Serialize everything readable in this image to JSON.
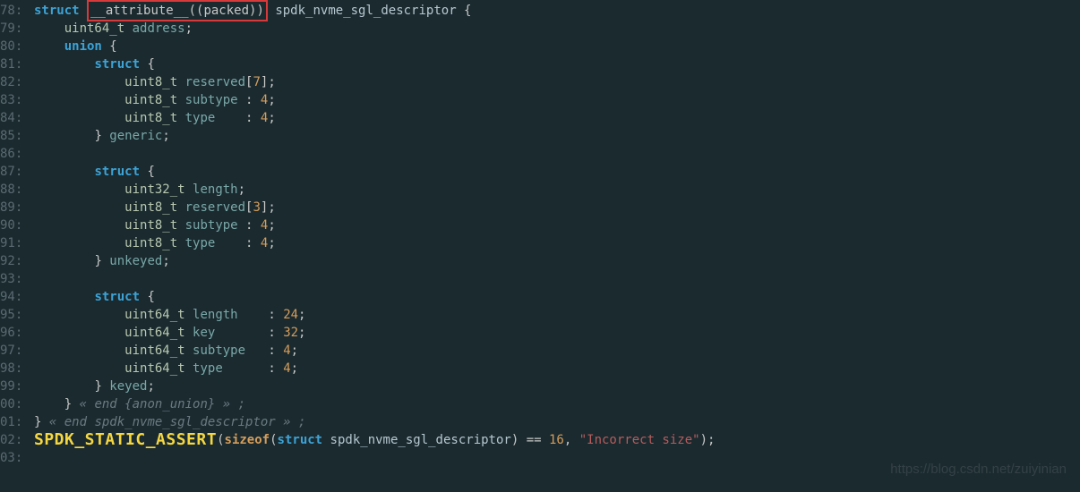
{
  "lines": [
    {
      "num": "78:",
      "indent": 0,
      "tokens": [
        {
          "t": "struct",
          "c": "kw-struct"
        },
        {
          "t": " "
        },
        {
          "t": "__attribute__((packed))",
          "c": "boxed"
        },
        {
          "t": " "
        },
        {
          "t": "spdk_nvme_sgl_descriptor",
          "c": "struct-name"
        },
        {
          "t": " {",
          "c": "punct"
        }
      ]
    },
    {
      "num": "79:",
      "indent": 1,
      "tokens": [
        {
          "t": "uint64_t",
          "c": "type-uint"
        },
        {
          "t": " "
        },
        {
          "t": "address",
          "c": "field"
        },
        {
          "t": ";",
          "c": "punct"
        }
      ]
    },
    {
      "num": "80:",
      "indent": 1,
      "tokens": [
        {
          "t": "union",
          "c": "kw-union"
        },
        {
          "t": " {",
          "c": "punct"
        }
      ]
    },
    {
      "num": "81:",
      "indent": 2,
      "tokens": [
        {
          "t": "struct",
          "c": "kw-struct"
        },
        {
          "t": " {",
          "c": "punct"
        }
      ]
    },
    {
      "num": "82:",
      "indent": 3,
      "tokens": [
        {
          "t": "uint8_t",
          "c": "type-uint"
        },
        {
          "t": " "
        },
        {
          "t": "reserved",
          "c": "field"
        },
        {
          "t": "[",
          "c": "punct"
        },
        {
          "t": "7",
          "c": "num"
        },
        {
          "t": "];",
          "c": "punct"
        }
      ]
    },
    {
      "num": "83:",
      "indent": 3,
      "tokens": [
        {
          "t": "uint8_t",
          "c": "type-uint"
        },
        {
          "t": " "
        },
        {
          "t": "subtype",
          "c": "field"
        },
        {
          "t": " : ",
          "c": "punct"
        },
        {
          "t": "4",
          "c": "num"
        },
        {
          "t": ";",
          "c": "punct"
        }
      ]
    },
    {
      "num": "84:",
      "indent": 3,
      "tokens": [
        {
          "t": "uint8_t",
          "c": "type-uint"
        },
        {
          "t": " "
        },
        {
          "t": "type",
          "c": "field"
        },
        {
          "t": "    : ",
          "c": "punct"
        },
        {
          "t": "4",
          "c": "num"
        },
        {
          "t": ";",
          "c": "punct"
        }
      ]
    },
    {
      "num": "85:",
      "indent": 2,
      "tokens": [
        {
          "t": "} ",
          "c": "punct"
        },
        {
          "t": "generic",
          "c": "field"
        },
        {
          "t": ";",
          "c": "punct"
        }
      ]
    },
    {
      "num": "86:",
      "indent": 0,
      "tokens": []
    },
    {
      "num": "87:",
      "indent": 2,
      "tokens": [
        {
          "t": "struct",
          "c": "kw-struct"
        },
        {
          "t": " {",
          "c": "punct"
        }
      ]
    },
    {
      "num": "88:",
      "indent": 3,
      "tokens": [
        {
          "t": "uint32_t",
          "c": "type-uint"
        },
        {
          "t": " "
        },
        {
          "t": "length",
          "c": "field"
        },
        {
          "t": ";",
          "c": "punct"
        }
      ]
    },
    {
      "num": "89:",
      "indent": 3,
      "tokens": [
        {
          "t": "uint8_t",
          "c": "type-uint"
        },
        {
          "t": " "
        },
        {
          "t": "reserved",
          "c": "field"
        },
        {
          "t": "[",
          "c": "punct"
        },
        {
          "t": "3",
          "c": "num"
        },
        {
          "t": "];",
          "c": "punct"
        }
      ]
    },
    {
      "num": "90:",
      "indent": 3,
      "tokens": [
        {
          "t": "uint8_t",
          "c": "type-uint"
        },
        {
          "t": " "
        },
        {
          "t": "subtype",
          "c": "field"
        },
        {
          "t": " : ",
          "c": "punct"
        },
        {
          "t": "4",
          "c": "num"
        },
        {
          "t": ";",
          "c": "punct"
        }
      ]
    },
    {
      "num": "91:",
      "indent": 3,
      "tokens": [
        {
          "t": "uint8_t",
          "c": "type-uint"
        },
        {
          "t": " "
        },
        {
          "t": "type",
          "c": "field"
        },
        {
          "t": "    : ",
          "c": "punct"
        },
        {
          "t": "4",
          "c": "num"
        },
        {
          "t": ";",
          "c": "punct"
        }
      ]
    },
    {
      "num": "92:",
      "indent": 2,
      "tokens": [
        {
          "t": "} ",
          "c": "punct"
        },
        {
          "t": "unkeyed",
          "c": "field"
        },
        {
          "t": ";",
          "c": "punct"
        }
      ]
    },
    {
      "num": "93:",
      "indent": 0,
      "tokens": []
    },
    {
      "num": "94:",
      "indent": 2,
      "tokens": [
        {
          "t": "struct",
          "c": "kw-struct"
        },
        {
          "t": " {",
          "c": "punct"
        }
      ]
    },
    {
      "num": "95:",
      "indent": 3,
      "tokens": [
        {
          "t": "uint64_t",
          "c": "type-uint"
        },
        {
          "t": " "
        },
        {
          "t": "length",
          "c": "field"
        },
        {
          "t": "    : ",
          "c": "punct"
        },
        {
          "t": "24",
          "c": "num"
        },
        {
          "t": ";",
          "c": "punct"
        }
      ]
    },
    {
      "num": "96:",
      "indent": 3,
      "tokens": [
        {
          "t": "uint64_t",
          "c": "type-uint"
        },
        {
          "t": " "
        },
        {
          "t": "key",
          "c": "field"
        },
        {
          "t": "       : ",
          "c": "punct"
        },
        {
          "t": "32",
          "c": "num"
        },
        {
          "t": ";",
          "c": "punct"
        }
      ]
    },
    {
      "num": "97:",
      "indent": 3,
      "tokens": [
        {
          "t": "uint64_t",
          "c": "type-uint"
        },
        {
          "t": " "
        },
        {
          "t": "subtype",
          "c": "field"
        },
        {
          "t": "   : ",
          "c": "punct"
        },
        {
          "t": "4",
          "c": "num"
        },
        {
          "t": ";",
          "c": "punct"
        }
      ]
    },
    {
      "num": "98:",
      "indent": 3,
      "tokens": [
        {
          "t": "uint64_t",
          "c": "type-uint"
        },
        {
          "t": " "
        },
        {
          "t": "type",
          "c": "field"
        },
        {
          "t": "      : ",
          "c": "punct"
        },
        {
          "t": "4",
          "c": "num"
        },
        {
          "t": ";",
          "c": "punct"
        }
      ]
    },
    {
      "num": "99:",
      "indent": 2,
      "tokens": [
        {
          "t": "} ",
          "c": "punct"
        },
        {
          "t": "keyed",
          "c": "field"
        },
        {
          "t": ";",
          "c": "punct"
        }
      ]
    },
    {
      "num": "00:",
      "indent": 1,
      "tokens": [
        {
          "t": "}",
          "c": "punct"
        },
        {
          "t": " « end {anon_union} » ;",
          "c": "comment"
        }
      ]
    },
    {
      "num": "01:",
      "indent": 0,
      "tokens": [
        {
          "t": "}",
          "c": "punct"
        },
        {
          "t": " « end spdk_nvme_sgl_descriptor » ;",
          "c": "comment"
        }
      ]
    },
    {
      "num": "02:",
      "indent": 0,
      "tokens": [
        {
          "t": "SPDK_STATIC_ASSERT",
          "c": "assert-macro"
        },
        {
          "t": "(",
          "c": "punct"
        },
        {
          "t": "sizeof",
          "c": "sizeof-kw"
        },
        {
          "t": "(",
          "c": "punct"
        },
        {
          "t": "struct",
          "c": "kw-struct"
        },
        {
          "t": " "
        },
        {
          "t": "spdk_nvme_sgl_descriptor",
          "c": "struct-name"
        },
        {
          "t": ") == ",
          "c": "punct"
        },
        {
          "t": "16",
          "c": "num"
        },
        {
          "t": ", ",
          "c": "punct"
        },
        {
          "t": "\"Incorrect size\"",
          "c": "string"
        },
        {
          "t": ");",
          "c": "punct"
        }
      ]
    },
    {
      "num": "03:",
      "indent": 0,
      "tokens": []
    }
  ],
  "indent_unit": "    ",
  "watermark": "https://blog.csdn.net/zuiyinian"
}
